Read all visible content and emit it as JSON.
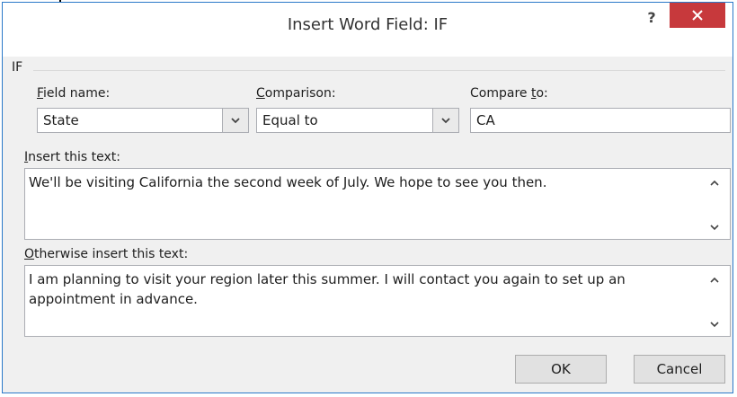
{
  "window": {
    "title": "Insert Word Field: IF",
    "help_label": "?",
    "accent_color": "#c7393c"
  },
  "group": {
    "label": "IF"
  },
  "field_name": {
    "label": "Field name:",
    "value": "State"
  },
  "comparison": {
    "label": "Comparison:",
    "value": "Equal to"
  },
  "compare_to": {
    "label": "Compare to:",
    "value": "CA"
  },
  "insert_text": {
    "label": "Insert this text:",
    "value": "We'll be visiting California the second week of July. We hope to see you then."
  },
  "otherwise_text": {
    "label": "Otherwise insert this text:",
    "value": "I am planning to visit your region later this summer. I will contact you again to set up an appointment in advance."
  },
  "buttons": {
    "ok_label": "OK",
    "cancel_label": "Cancel"
  },
  "icons": {
    "close": "close-icon",
    "dropdown": "chevron-down-icon",
    "scroll_up": "chevron-up-icon",
    "scroll_down": "chevron-down-icon"
  }
}
